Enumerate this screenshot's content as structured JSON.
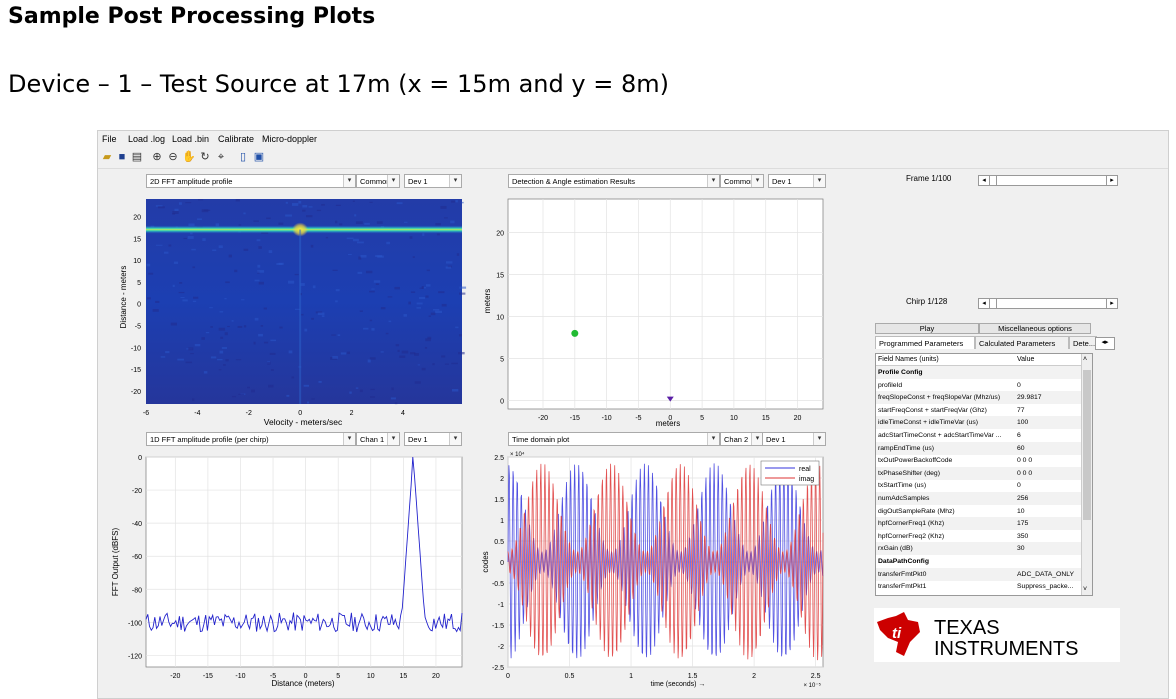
{
  "doc": {
    "heading": "Sample Post Processing Plots",
    "subheading": "Device – 1 – Test Source at 17m (x = 15m and y = 8m)"
  },
  "menu": [
    "File",
    "Load .log",
    "Load .bin",
    "Calibrate",
    "Micro-doppler"
  ],
  "toolbar_icons": [
    "open-icon",
    "save-icon",
    "print-icon",
    "zoom-in-icon",
    "zoom-out-icon",
    "pan-icon",
    "rotate-icon",
    "data-cursor-icon",
    "colorbar-icon",
    "legend-icon"
  ],
  "panels": {
    "p1": {
      "select": "2D FFT amplitude profile",
      "opt1": "Common",
      "opt2": "Dev 1"
    },
    "p2": {
      "select": "Detection & Angle estimation Results",
      "opt1": "Common",
      "opt2": "Dev 1"
    },
    "p3": {
      "select": "1D FFT amplitude profile (per chirp)",
      "opt1": "Chan 1",
      "opt2": "Dev 1"
    },
    "p4": {
      "select": "Time domain plot",
      "opt1": "Chan 2",
      "opt2": "Dev 1"
    }
  },
  "side": {
    "frame_label": "Frame 1/100",
    "chirp_label": "Chirp 1/128",
    "play_button": "Play",
    "misc_button": "Miscellaneous options",
    "tabs": [
      "Programmed Parameters",
      "Calculated Parameters",
      "Dete..."
    ],
    "table_headers": [
      "Field Names    (units)",
      "Value"
    ],
    "table_rows": [
      {
        "name": "Profile Config",
        "value": "",
        "section": true
      },
      {
        "name": "profileId",
        "value": "0"
      },
      {
        "name": "freqSlopeConst + freqSlopeVar (Mhz/us)",
        "value": "29.9817"
      },
      {
        "name": "startFreqConst + startFreqVar (Ghz)",
        "value": "77"
      },
      {
        "name": "idleTimeConst + idleTimeVar (us)",
        "value": "100"
      },
      {
        "name": "adcStartTimeConst + adcStartTimeVar ...",
        "value": "6"
      },
      {
        "name": "rampEndTime (us)",
        "value": "60"
      },
      {
        "name": "txOutPowerBackoffCode",
        "value": "0 0 0"
      },
      {
        "name": "txPhaseShifter (deg)",
        "value": "0 0 0"
      },
      {
        "name": "txStartTime (us)",
        "value": "0"
      },
      {
        "name": "numAdcSamples",
        "value": "256"
      },
      {
        "name": "digOutSampleRate (Mhz)",
        "value": "10"
      },
      {
        "name": "hpfCornerFreq1 (Khz)",
        "value": "175"
      },
      {
        "name": "hpfCornerFreq2 (Khz)",
        "value": "350"
      },
      {
        "name": "rxGain (dB)",
        "value": "30"
      },
      {
        "name": "DataPathConfig",
        "value": "",
        "section": true
      },
      {
        "name": "transferFmtPkt0",
        "value": "ADC_DATA_ONLY"
      },
      {
        "name": "transferFmtPkt1",
        "value": "Suppress_packe..."
      }
    ],
    "logo_line1": "TEXAS",
    "logo_line2": "INSTRUMENTS",
    "logo_color": "#cc0000"
  },
  "chart_data": [
    {
      "type": "heatmap",
      "title": "",
      "xlabel": "Velocity - meters/sec",
      "ylabel": "Distance - meters",
      "x_ticks": [
        "-6",
        "-4",
        "-2",
        "0",
        "2",
        "4"
      ],
      "y_ticks": [
        "20",
        "15",
        "10",
        "5",
        "0",
        "-5",
        "-10",
        "-15",
        "-20"
      ],
      "xlim": [
        -6,
        6.3
      ],
      "ylim": [
        -23,
        24
      ],
      "peak": {
        "x": 0,
        "y": 17
      },
      "colors": [
        "#2a1fa0",
        "#1d73d6",
        "#33d1b7",
        "#f3e23a"
      ]
    },
    {
      "type": "scatter",
      "xlabel": "meters",
      "ylabel": "meters",
      "x_ticks": [
        "-20",
        "-15",
        "-10",
        "-5",
        "0",
        "5",
        "10",
        "15",
        "20"
      ],
      "y_ticks": [
        "0",
        "5",
        "10",
        "15",
        "20"
      ],
      "xlim": [
        -25.5,
        24
      ],
      "ylim": [
        -1,
        24
      ],
      "points": [
        {
          "x": -15,
          "y": 8,
          "color": "#22bb33"
        },
        {
          "x": 0,
          "y": 0,
          "color": "#5a1ea6"
        }
      ]
    },
    {
      "type": "line",
      "xlabel": "Distance (meters)",
      "ylabel": "FFT Output (dBFS)",
      "x_ticks": [
        "-20",
        "-15",
        "-10",
        "-5",
        "0",
        "5",
        "10",
        "15",
        "20"
      ],
      "y_ticks": [
        "0",
        "-20",
        "-40",
        "-60",
        "-80",
        "-100",
        "-120"
      ],
      "xlim": [
        -24.5,
        24
      ],
      "ylim": [
        -127,
        0
      ],
      "noise_floor": -100,
      "peak": {
        "x": 16.5,
        "y": 0
      },
      "color": "#2222cc"
    },
    {
      "type": "line",
      "xlabel": "time (seconds) →",
      "ylabel": "codes",
      "y_ticks": [
        "2.5",
        "2",
        "1.5",
        "1",
        "0.5",
        "0",
        "-0.5",
        "-1",
        "-1.5",
        "-2",
        "-2.5"
      ],
      "x_ticks": [
        "0",
        "0.5",
        "1",
        "1.5",
        "2",
        "2.5"
      ],
      "x_exponent": "× 10⁻⁵",
      "y_exponent": "× 10⁴",
      "xlim": [
        0,
        2.56
      ],
      "ylim": [
        -2.5,
        2.5
      ],
      "series": [
        {
          "name": "real",
          "color": "#3333dd"
        },
        {
          "name": "imag",
          "color": "#dd3333"
        }
      ]
    }
  ]
}
